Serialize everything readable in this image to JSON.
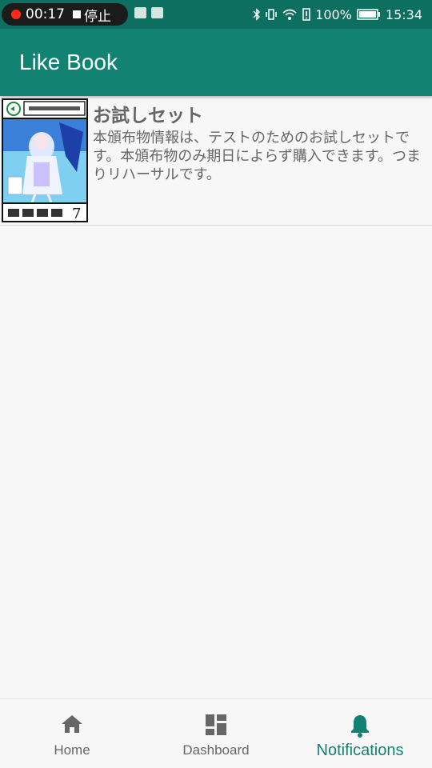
{
  "status_bar": {
    "record_time": "00:17",
    "stop_label": "停止",
    "battery": "100%",
    "clock": "15:34"
  },
  "app_bar": {
    "title": "Like Book"
  },
  "list": [
    {
      "title": "お試しセット",
      "description": "本頒布物情報は、テストのためのお試しセットです。本頒布物のみ期日によらず購入できます。つまりリハーサルです。",
      "thumbnail_icon": "book-cover-image"
    }
  ],
  "bottom_nav": {
    "items": [
      {
        "label": "Home",
        "icon": "home-icon"
      },
      {
        "label": "Dashboard",
        "icon": "dashboard-icon"
      },
      {
        "label": "Notifications",
        "icon": "bell-icon"
      }
    ],
    "active": "Notifications"
  },
  "colors": {
    "primary": "#128373",
    "primary_dark": "#0d6f60",
    "text": "#666666"
  }
}
